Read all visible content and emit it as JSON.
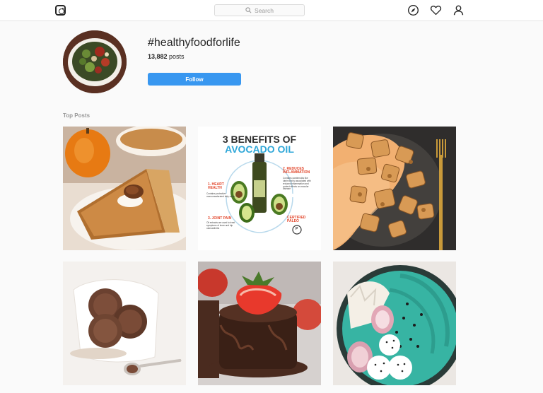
{
  "header": {
    "search_placeholder": "Search",
    "icons": [
      "instagram-logo-icon",
      "explore-compass-icon",
      "heart-icon",
      "profile-icon"
    ]
  },
  "hashtag": {
    "title": "#healthyfoodforlife",
    "posts_count": "13,882",
    "posts_label": "posts",
    "follow_label": "Follow"
  },
  "section": {
    "top_posts_label": "Top Posts"
  },
  "posts": [
    {
      "subject": "pumpkin pie slice"
    },
    {
      "subject": "avocado oil infographic",
      "heading_line1": "3 BENEFITS OF",
      "heading_line2": "AVOCADO OIL",
      "benefit1_title": "1. HEART HEALTH",
      "benefit1_text": "Contains protective monounsaturated fatty acids",
      "benefit2_title": "2. REDUCES INFLAMMATION",
      "benefit2_text": "Contains carotenoids like lutein that is associated with reduced inflammation and protect effects on macular disease",
      "benefit3_title": "3. JOINT PAIN",
      "benefit3_text": "Oil extracts are used to treat symptoms of knee and hip osteoarthritis",
      "badge": "CERTIFIED PALEO",
      "badge_letter": "P"
    },
    {
      "subject": "roasted potatoes with sauce"
    },
    {
      "subject": "chocolate ice cream scoops"
    },
    {
      "subject": "chocolate fudge with strawberry"
    },
    {
      "subject": "spirulina smoothie bowl"
    }
  ],
  "colors": {
    "follow_button": "#3897f0",
    "accent_blue": "#2fa7d8",
    "accent_red": "#e2462b"
  }
}
